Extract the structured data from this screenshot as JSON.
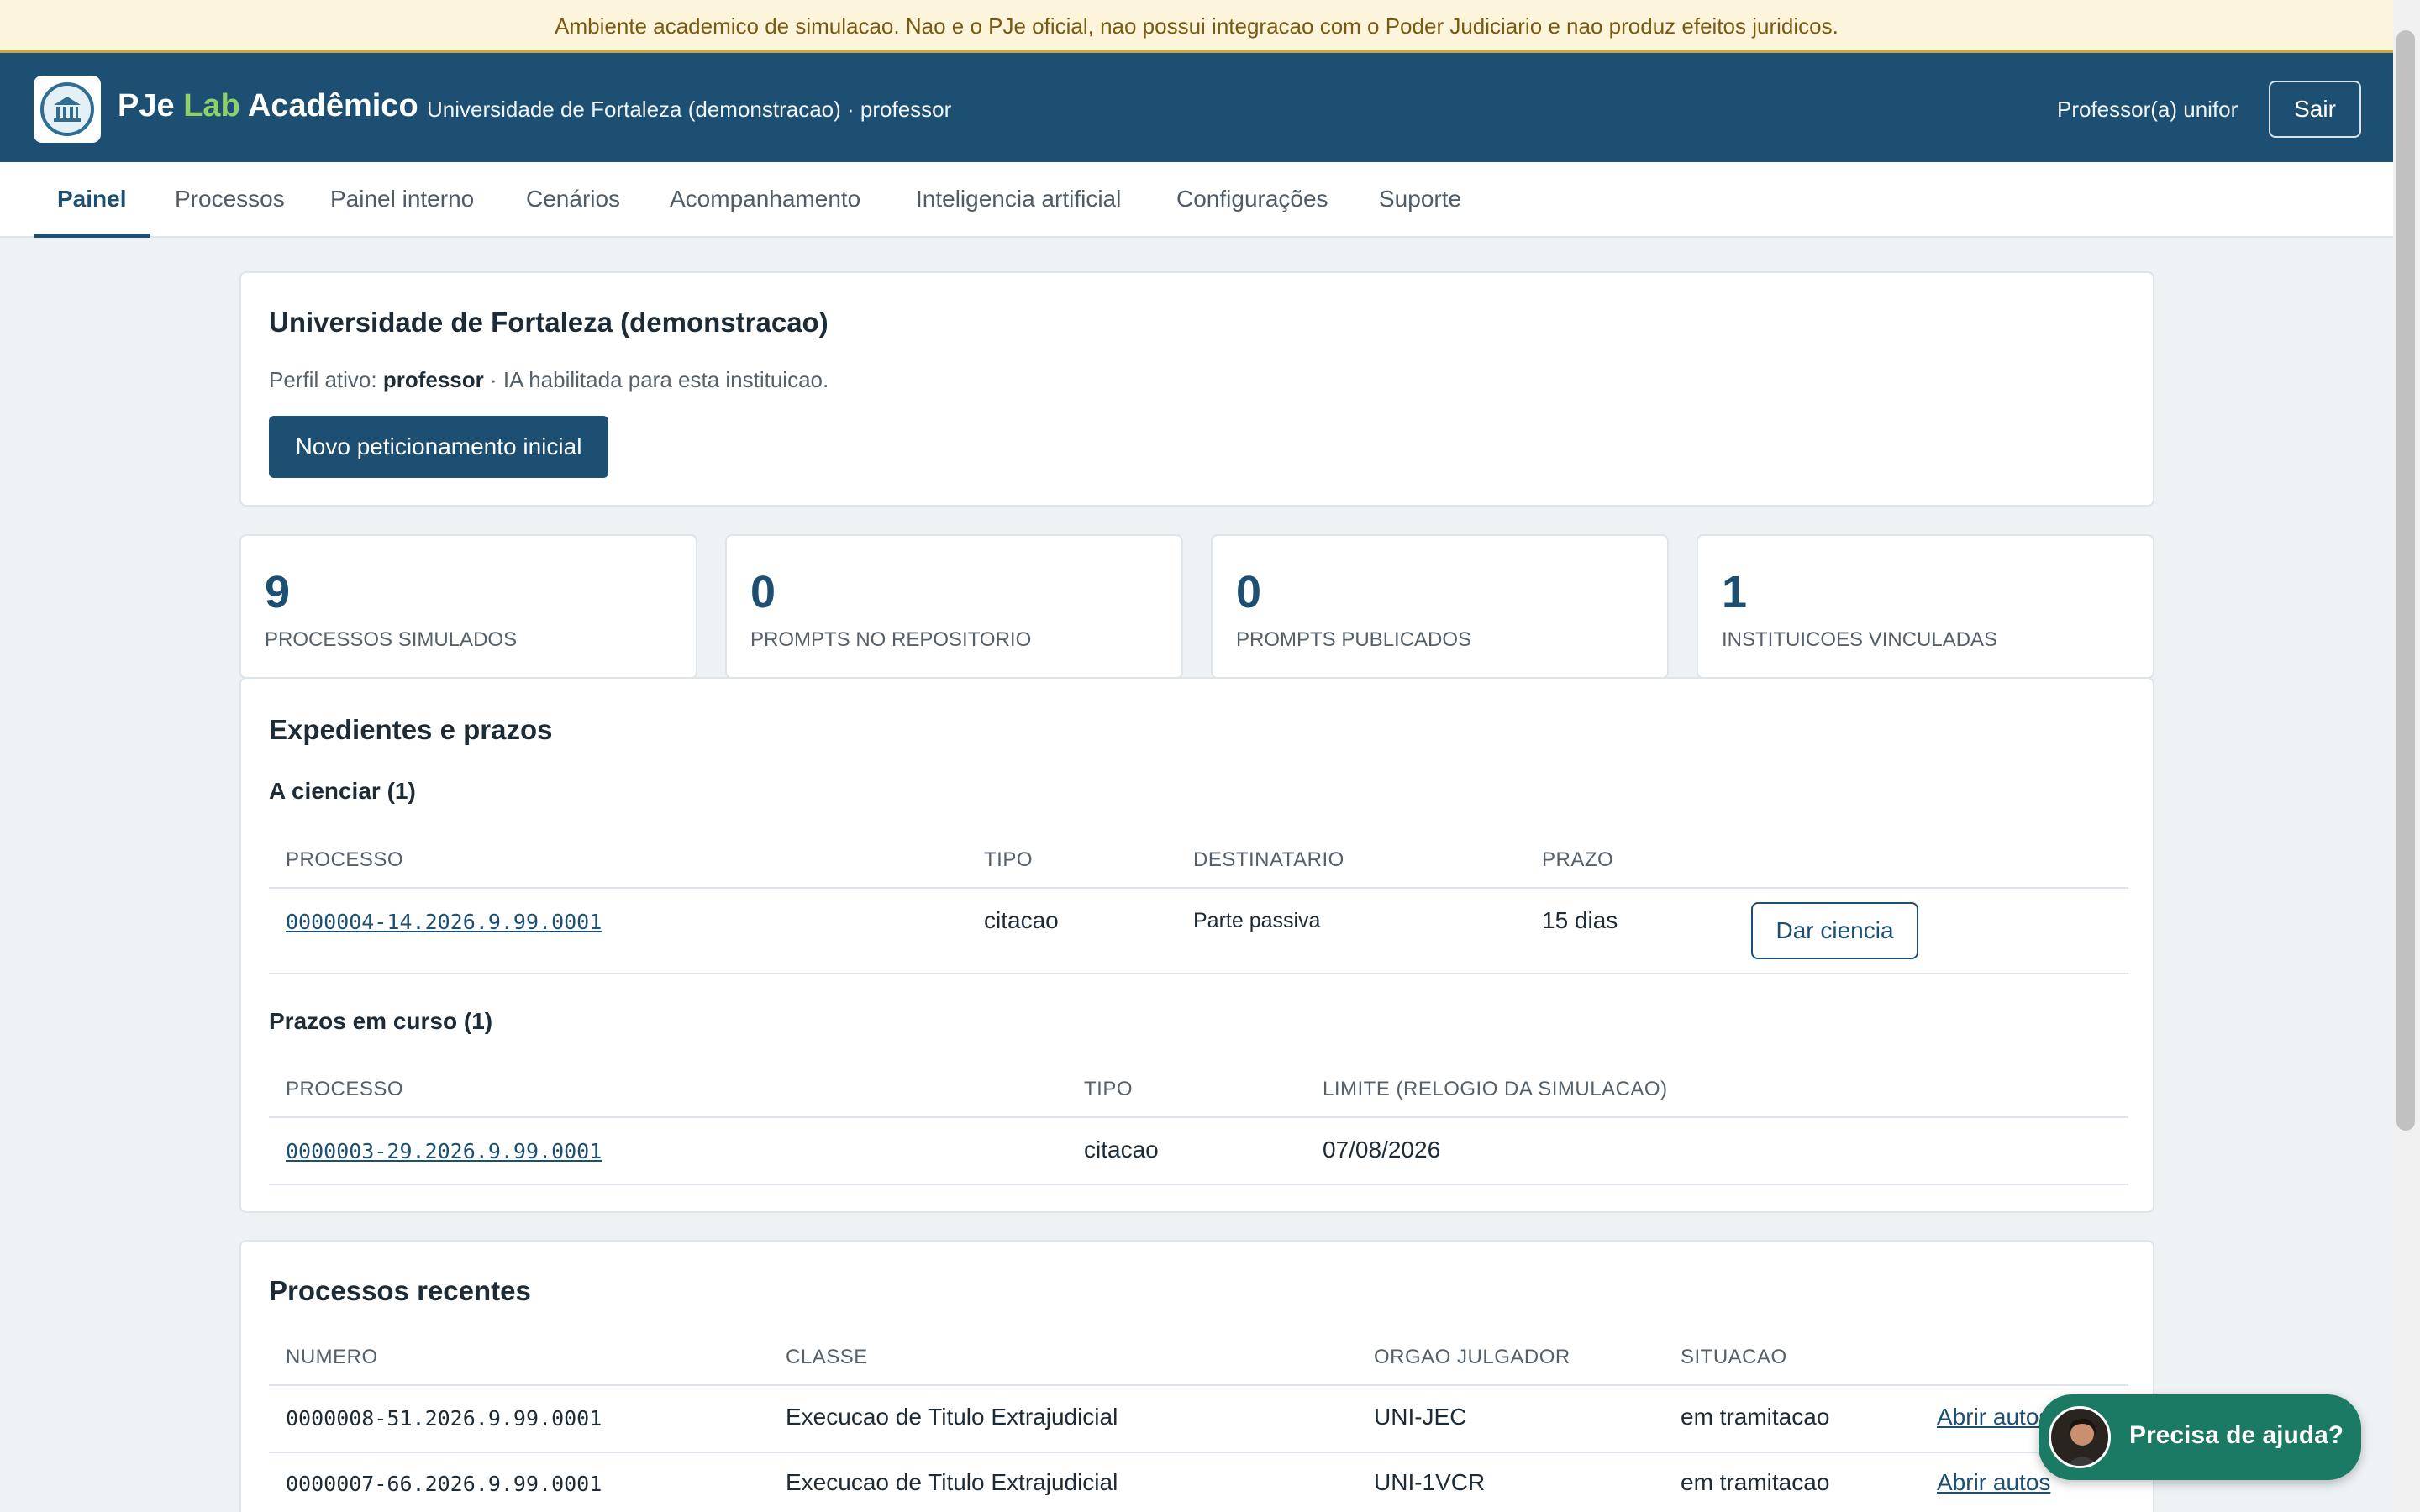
{
  "banner": {
    "text": "Ambiente academico de simulacao. Nao e o PJe oficial, nao possui integracao com o Poder Judiciario e nao produz efeitos juridicos."
  },
  "header": {
    "brand_pje": "PJe",
    "brand_lab": "Lab",
    "brand_rest": "Acadêmico",
    "institution_role": "Universidade de Fortaleza (demonstracao) · professor",
    "user": "Professor(a) unifor",
    "logout_label": "Sair"
  },
  "nav": {
    "tabs": [
      {
        "label": "Painel",
        "active": true
      },
      {
        "label": "Processos"
      },
      {
        "label": "Painel interno"
      },
      {
        "label": "Cenários"
      },
      {
        "label": "Acompanhamento"
      },
      {
        "label": "Inteligencia artificial"
      },
      {
        "label": "Configurações"
      },
      {
        "label": "Suporte"
      }
    ]
  },
  "intro": {
    "title": "Universidade de Fortaleza (demonstracao)",
    "profile_prefix": "Perfil ativo: ",
    "profile_role": "professor",
    "profile_suffix": " · IA habilitada para esta instituicao.",
    "new_button": "Novo peticionamento inicial"
  },
  "stats": [
    {
      "value": "9",
      "label": "PROCESSOS SIMULADOS"
    },
    {
      "value": "0",
      "label": "PROMPTS NO REPOSITORIO"
    },
    {
      "value": "0",
      "label": "PROMPTS PUBLICADOS"
    },
    {
      "value": "1",
      "label": "INSTITUICOES VINCULADAS"
    }
  ],
  "expedientes": {
    "title": "Expedientes e prazos",
    "a_cienciar": {
      "title": "A cienciar (1)",
      "headers": [
        "PROCESSO",
        "TIPO",
        "DESTINATARIO",
        "PRAZO"
      ],
      "rows": [
        {
          "processo": "0000004-14.2026.9.99.0001",
          "tipo": "citacao",
          "destinatario": "Parte passiva",
          "prazo": "15 dias",
          "action": "Dar ciencia"
        }
      ]
    },
    "prazos": {
      "title": "Prazos em curso (1)",
      "headers": [
        "PROCESSO",
        "TIPO",
        "LIMITE (RELOGIO DA SIMULACAO)"
      ],
      "rows": [
        {
          "processo": "0000003-29.2026.9.99.0001",
          "tipo": "citacao",
          "limite": "07/08/2026"
        }
      ]
    }
  },
  "recentes": {
    "title": "Processos recentes",
    "headers": [
      "NUMERO",
      "CLASSE",
      "ORGAO JULGADOR",
      "SITUACAO"
    ],
    "rows": [
      {
        "numero": "0000008-51.2026.9.99.0001",
        "classe": "Execucao de Titulo Extrajudicial",
        "orgao": "UNI-JEC",
        "situacao": "em tramitacao",
        "action": "Abrir autos"
      },
      {
        "numero": "0000007-66.2026.9.99.0001",
        "classe": "Execucao de Titulo Extrajudicial",
        "orgao": "UNI-1VCR",
        "situacao": "em tramitacao",
        "action": "Abrir autos"
      }
    ]
  },
  "help": {
    "label": "Precisa de ajuda?"
  }
}
